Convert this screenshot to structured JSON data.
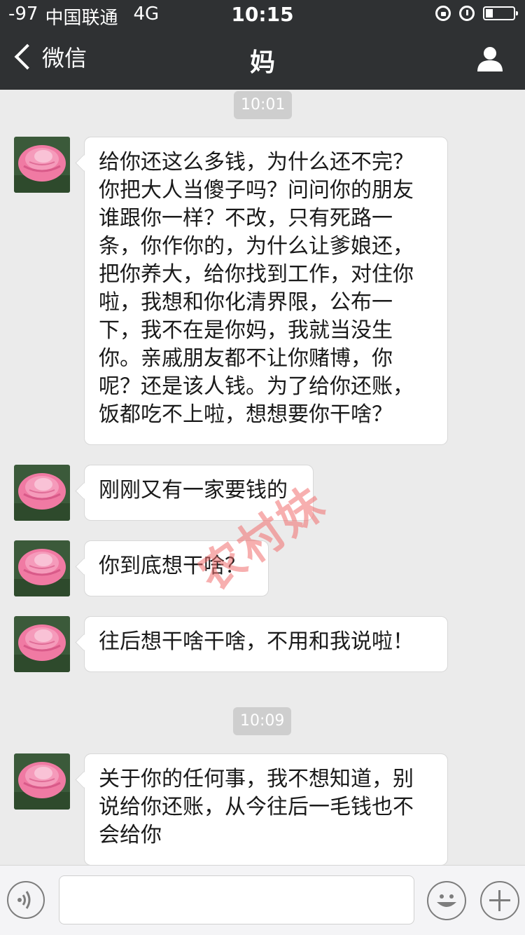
{
  "status_bar": {
    "signal": "-97",
    "carrier": "中国联通",
    "network": "4G",
    "time": "10:15"
  },
  "nav": {
    "back_label": "微信",
    "title": "妈"
  },
  "messages": [
    {
      "type": "time",
      "text": "10:01"
    },
    {
      "type": "message",
      "sender": "妈",
      "text": "给你还这么多钱，为什么还不完？你把大人当傻子吗？问问你的朋友谁跟你一样？不改，只有死路一条，你作你的，为什么让爹娘还，把你养大，给你找到工作，对住你啦，我想和你化清界限，公布一下，我不在是你妈，我就当没生你。亲戚朋友都不让你赌博，你呢？还是该人钱。为了给你还账，饭都吃不上啦，想想要你干啥？"
    },
    {
      "type": "message",
      "sender": "妈",
      "text": "刚刚又有一家要钱的"
    },
    {
      "type": "message",
      "sender": "妈",
      "text": "你到底想干啥？"
    },
    {
      "type": "message",
      "sender": "妈",
      "text": "往后想干啥干啥，不用和我说啦！"
    },
    {
      "type": "time",
      "text": "10:09"
    },
    {
      "type": "message",
      "sender": "妈",
      "text": "关于你的任何事，我不想知道，别说给你还账，从今往后一毛钱也不会给你"
    }
  ],
  "watermark": "农村妹",
  "input_bar": {
    "placeholder": "",
    "value": ""
  },
  "colors": {
    "nav_bg": "#2f3133",
    "chat_bg": "#ebebeb",
    "bubble_bg": "#ffffff",
    "timestamp_bg": "#cecece"
  },
  "icons": [
    "back-chevron-icon",
    "profile-icon",
    "voice-icon",
    "emoji-icon",
    "plus-icon",
    "rotation-lock-icon",
    "alarm-icon",
    "battery-icon"
  ]
}
